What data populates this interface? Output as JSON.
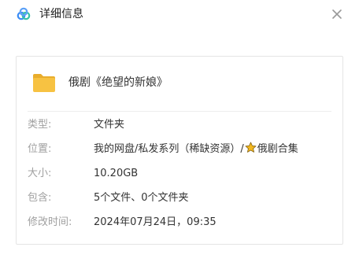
{
  "dialog": {
    "title": "详细信息",
    "logo_icon": "cloud-logo-icon",
    "close_icon": "close-icon"
  },
  "item": {
    "icon": "folder-icon",
    "name": "俄剧《绝望的新娘》"
  },
  "details": {
    "type": {
      "label": "类型:",
      "value": "文件夹"
    },
    "location": {
      "label": "位置:",
      "path_prefix": "我的网盘/私发系列（稀缺资源）/",
      "star_icon": "star-icon",
      "path_suffix": "俄剧合集"
    },
    "size": {
      "label": "大小:",
      "value": "10.20GB"
    },
    "contains": {
      "label": "包含:",
      "value": "5个文件、0个文件夹"
    },
    "modified": {
      "label": "修改时间:",
      "value": "2024年07月24日，09:35"
    }
  },
  "colors": {
    "folder": "#f7c242",
    "star": "#f3b81f",
    "label": "#a0a0a0",
    "text": "#333333"
  }
}
